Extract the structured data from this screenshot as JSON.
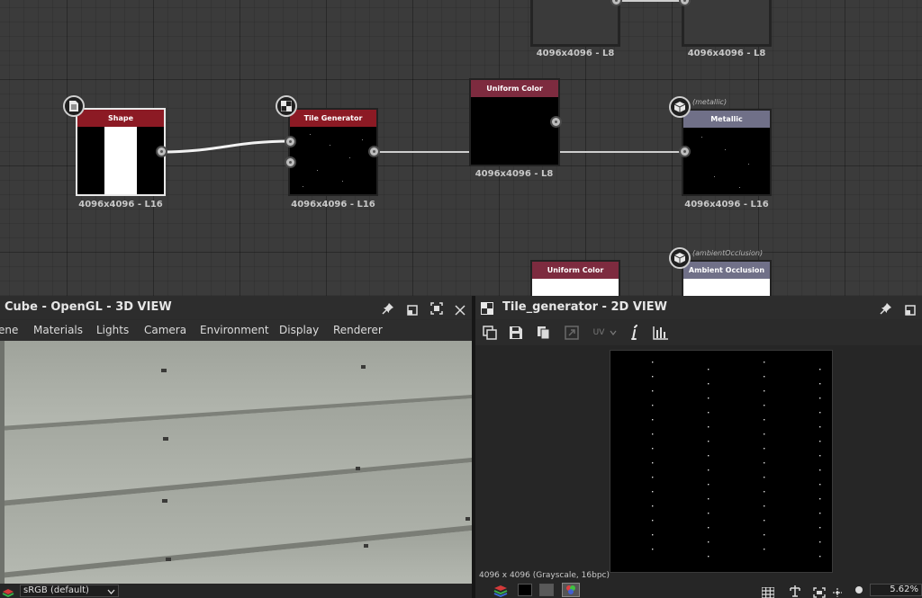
{
  "graph": {
    "nodes": {
      "shape": {
        "title": "Shape",
        "caption": "4096x4096 - L16",
        "icon": "document-icon"
      },
      "tile_generator": {
        "title": "Tile Generator",
        "caption": "4096x4096 - L16",
        "icon": "checker-icon"
      },
      "uniform_color_top": {
        "title": "Uniform Color",
        "caption": "4096x4096 - L8"
      },
      "metallic": {
        "title": "Metallic",
        "caption": "4096x4096 - L16",
        "tag": "(metallic)",
        "icon": "cube-icon"
      },
      "uniform_color_bottom": {
        "title": "Uniform Color"
      },
      "ambient_occlusion": {
        "title": "Ambient Occlusion",
        "tag": "(ambientOcclusion)",
        "icon": "cube-icon"
      },
      "ghost_left": {
        "caption": "4096x4096 - L8"
      },
      "ghost_right": {
        "caption": "4096x4096 - L8"
      }
    },
    "colors": {
      "title_red": "#8c1a24",
      "title_wine": "#7d2b3f",
      "title_slate": "#707088",
      "link": "#d8d8d8"
    }
  },
  "view3d": {
    "title": "Cube - OpenGL - 3D VIEW",
    "menu": [
      "ene",
      "Materials",
      "Lights",
      "Camera",
      "Environment",
      "Display",
      "Renderer"
    ],
    "colorspace": "sRGB (default)",
    "icons": [
      "pin-icon",
      "restore-icon",
      "maximize-icon",
      "close-icon"
    ]
  },
  "view2d": {
    "title": "Tile_generator - 2D VIEW",
    "toolbar": {
      "uv_label": "UV",
      "icons": [
        "export-icon",
        "save-icon",
        "copy-icon",
        "link-icon",
        "uv-dropdown-icon",
        "info-icon",
        "histogram-icon"
      ]
    },
    "info": "4096 x 4096 (Grayscale, 16bpc)",
    "zoom": "5.62%",
    "icons": [
      "pin-icon",
      "restore-icon"
    ]
  }
}
